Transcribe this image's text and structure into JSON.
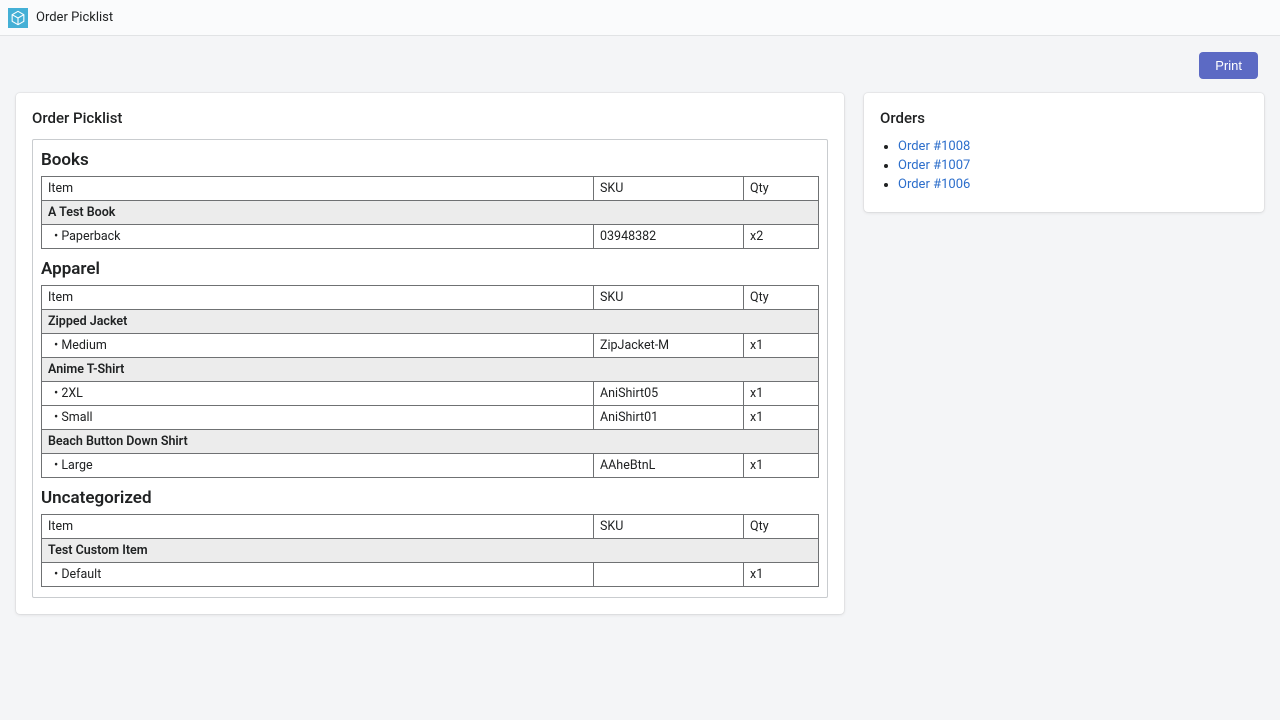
{
  "app_title": "Order Picklist",
  "actions": {
    "print_label": "Print"
  },
  "picklist": {
    "heading": "Order Picklist",
    "headers": {
      "item": "Item",
      "sku": "SKU",
      "qty": "Qty"
    },
    "categories": [
      {
        "name": "Books",
        "products": [
          {
            "name": "A Test Book",
            "variants": [
              {
                "name": "Paperback",
                "sku": "03948382",
                "qty": "x2"
              }
            ]
          }
        ]
      },
      {
        "name": "Apparel",
        "products": [
          {
            "name": "Zipped Jacket",
            "variants": [
              {
                "name": "Medium",
                "sku": "ZipJacket-M",
                "qty": "x1"
              }
            ]
          },
          {
            "name": "Anime T-Shirt",
            "variants": [
              {
                "name": "2XL",
                "sku": "AniShirt05",
                "qty": "x1"
              },
              {
                "name": "Small",
                "sku": "AniShirt01",
                "qty": "x1"
              }
            ]
          },
          {
            "name": "Beach Button Down Shirt",
            "variants": [
              {
                "name": "Large",
                "sku": "AAheBtnL",
                "qty": "x1"
              }
            ]
          }
        ]
      },
      {
        "name": "Uncategorized",
        "products": [
          {
            "name": "Test Custom Item",
            "variants": [
              {
                "name": "Default",
                "sku": "",
                "qty": "x1"
              }
            ]
          }
        ]
      }
    ]
  },
  "orders": {
    "heading": "Orders",
    "items": [
      {
        "label": "Order #1008"
      },
      {
        "label": "Order #1007"
      },
      {
        "label": "Order #1006"
      }
    ]
  }
}
